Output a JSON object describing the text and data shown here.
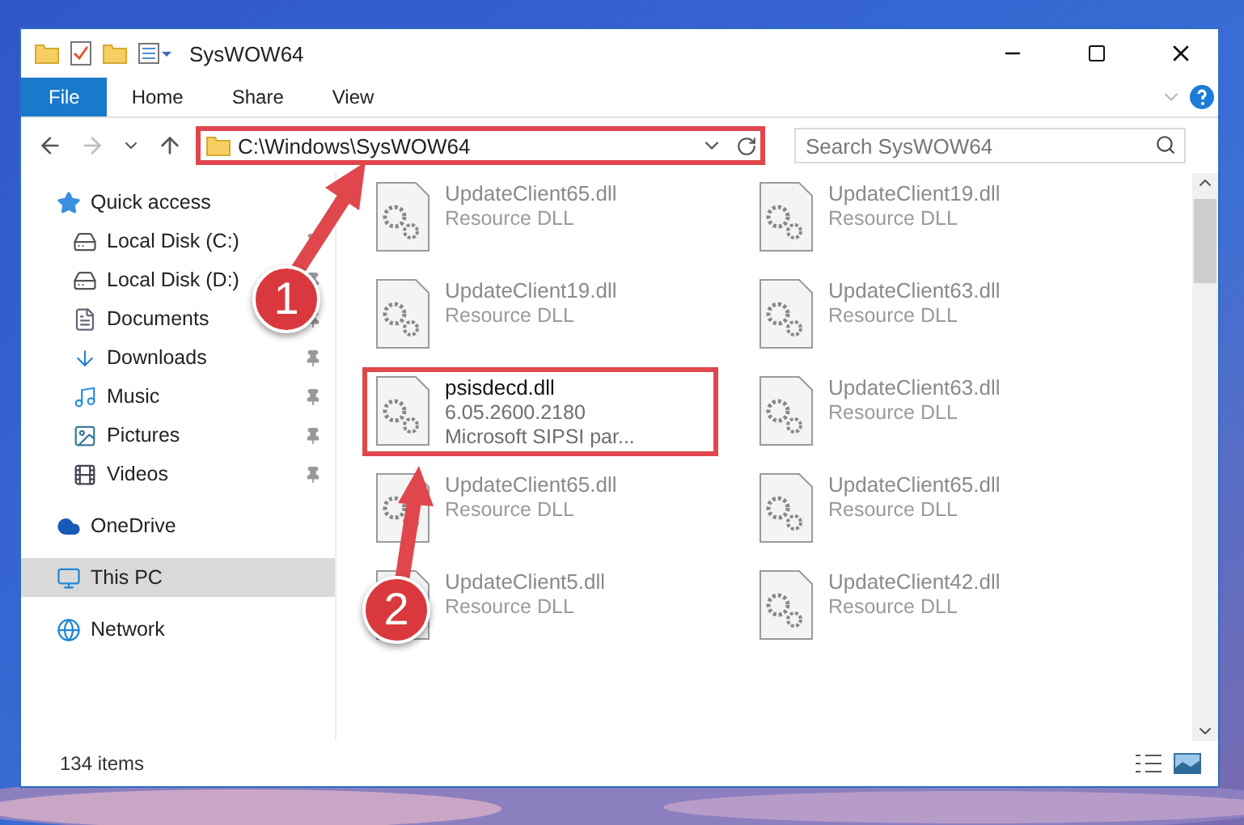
{
  "window": {
    "title": "SysWOW64"
  },
  "ribbon": {
    "tabs": [
      {
        "label": "File",
        "kind": "file"
      },
      {
        "label": "Home",
        "kind": "tab"
      },
      {
        "label": "Share",
        "kind": "tab"
      },
      {
        "label": "View",
        "kind": "tab"
      }
    ]
  },
  "address_bar": {
    "path": "C:\\Windows\\SysWOW64",
    "annotated": true
  },
  "search": {
    "placeholder": "Search SysWOW64"
  },
  "sidebar": {
    "items": [
      {
        "label": "Quick access",
        "kind": "star",
        "selected": false,
        "children": [
          {
            "label": "Local Disk (C:)",
            "kind": "disk-c",
            "pinned": true
          },
          {
            "label": "Local Disk (D:)",
            "kind": "disk",
            "pinned": true
          },
          {
            "label": "Documents",
            "kind": "documents",
            "pinned": true
          },
          {
            "label": "Downloads",
            "kind": "downloads",
            "pinned": true
          },
          {
            "label": "Music",
            "kind": "music",
            "pinned": true
          },
          {
            "label": "Pictures",
            "kind": "pictures",
            "pinned": true
          },
          {
            "label": "Videos",
            "kind": "videos",
            "pinned": true
          }
        ]
      },
      {
        "label": "OneDrive",
        "kind": "cloud",
        "selected": false
      },
      {
        "label": "This PC",
        "kind": "pc",
        "selected": true
      },
      {
        "label": "Network",
        "kind": "network",
        "selected": false
      }
    ]
  },
  "files": [
    {
      "name": "UpdateClient65.dll",
      "lines": [
        "Resource DLL"
      ],
      "dimmed": true,
      "annotated": false
    },
    {
      "name": "UpdateClient19.dll",
      "lines": [
        "Resource DLL"
      ],
      "dimmed": true,
      "annotated": false
    },
    {
      "name": "UpdateClient19.dll",
      "lines": [
        "Resource DLL"
      ],
      "dimmed": true,
      "annotated": false
    },
    {
      "name": "UpdateClient63.dll",
      "lines": [
        "Resource DLL"
      ],
      "dimmed": true,
      "annotated": false
    },
    {
      "name": "psisdecd.dll",
      "lines": [
        "6.05.2600.2180",
        "Microsoft SIPSI par..."
      ],
      "dimmed": false,
      "annotated": true
    },
    {
      "name": "UpdateClient63.dll",
      "lines": [
        "Resource DLL"
      ],
      "dimmed": true,
      "annotated": false
    },
    {
      "name": "UpdateClient65.dll",
      "lines": [
        "Resource DLL"
      ],
      "dimmed": true,
      "annotated": false
    },
    {
      "name": "UpdateClient65.dll",
      "lines": [
        "Resource DLL"
      ],
      "dimmed": true,
      "annotated": false
    },
    {
      "name": "UpdateClient5.dll",
      "lines": [
        "Resource DLL"
      ],
      "dimmed": true,
      "annotated": false
    },
    {
      "name": "UpdateClient42.dll",
      "lines": [
        "Resource DLL"
      ],
      "dimmed": true,
      "annotated": false
    }
  ],
  "status_bar": {
    "count": "134 items"
  },
  "callouts": [
    {
      "number": "1"
    },
    {
      "number": "2"
    }
  ]
}
